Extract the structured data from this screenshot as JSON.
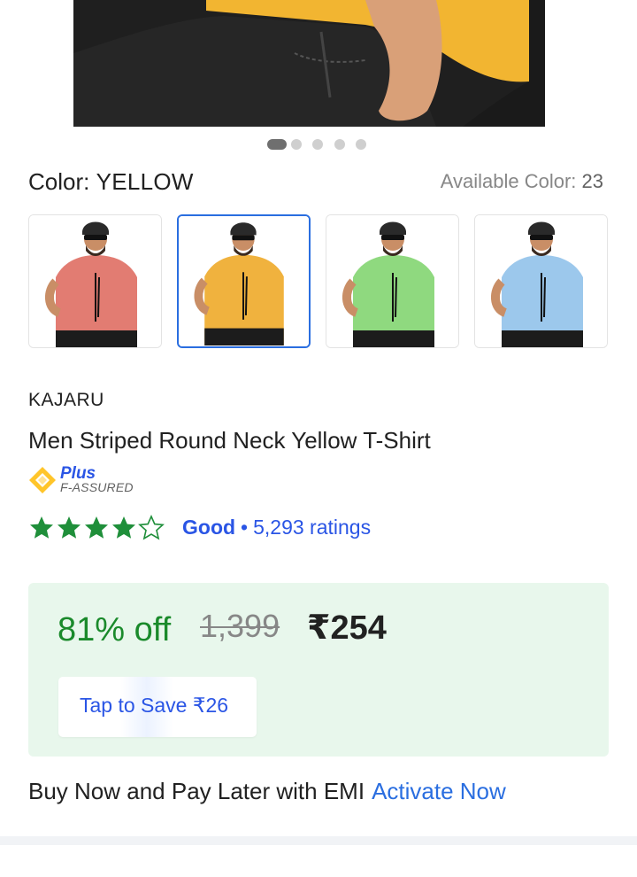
{
  "carousel": {
    "total_slides": 5,
    "active_index": 0
  },
  "color": {
    "label_prefix": "Color:",
    "selected": "YELLOW",
    "available_label": "Available Color:",
    "available_count": "23"
  },
  "swatches": [
    {
      "name": "coral",
      "shirt_color": "#e27c72",
      "selected": false
    },
    {
      "name": "yellow",
      "shirt_color": "#f0b23e",
      "selected": true
    },
    {
      "name": "green",
      "shirt_color": "#8fd97f",
      "selected": false
    },
    {
      "name": "sky-blue",
      "shirt_color": "#9cc8ec",
      "selected": false
    }
  ],
  "product": {
    "brand": "KAJARU",
    "title": "Men Striped Round Neck Yellow T-Shirt"
  },
  "assured": {
    "line1": "Plus",
    "line2": "F-ASSURED"
  },
  "rating": {
    "stars": 4,
    "max_stars": 5,
    "label": "Good",
    "separator": "•",
    "count_text": "5,293 ratings"
  },
  "pricing": {
    "discount": "81% off",
    "mrp": "1,399",
    "price": "₹254",
    "save_button": "Tap to Save ₹26"
  },
  "emi": {
    "text": "Buy Now and Pay Later with EMI",
    "link": "Activate Now"
  },
  "colors": {
    "accent_blue": "#2a55e5",
    "discount_green": "#1a8a2b",
    "price_box_bg": "#e8f7ec",
    "star_green": "#1f8f3a"
  }
}
